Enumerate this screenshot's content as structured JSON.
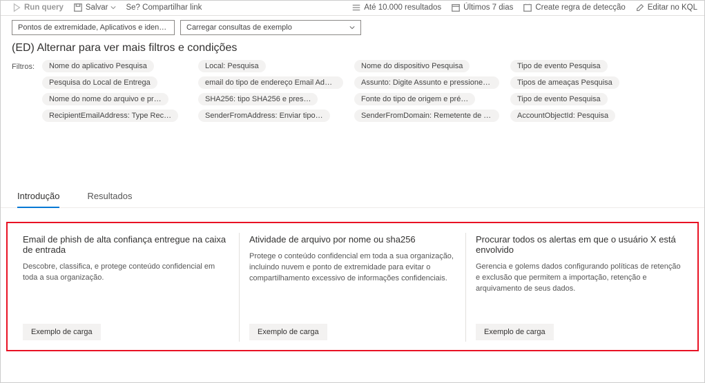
{
  "toolbar": {
    "run": "Run query",
    "save": "Salvar",
    "share": "Se? Compartilhar link",
    "results_limit": "Até 10.000 resultados",
    "time_range": "Últimos 7 dias",
    "create_rule": "Create regra de detecção",
    "edit_kql": "Editar no KQL"
  },
  "scope_box": "Pontos de extremidade, Aplicativos e identidades - Atividade\".",
  "sample_box": "Carregar consultas de exemplo",
  "heading": "(ED) Alternar para ver mais filtros e condições",
  "filters_label": "Filtros:",
  "filters": [
    "Nome do aplicativo Pesquisa",
    "Local: Pesquisa",
    "Nome do dispositivo Pesquisa",
    "Tipo de evento Pesquisa",
    "Pesquisa do Local de Entrega",
    "email do tipo de endereço Email Addres…",
    "Assunto: Digite Assunto e pressione …",
    "Tipos de ameaças Pesquisa",
    "Nome do nome do arquivo e pr…",
    "SHA256: tipo SHA256 e pres…",
    "Fonte do tipo de origem e pré…",
    "Tipo de evento Pesquisa",
    "RecipientEmailAddress: Type Rec…",
    "SenderFromAddress: Enviar tipo…",
    "SenderFromDomain: Remetente de Tipo",
    "AccountObjectId: Pesquisa"
  ],
  "tabs": {
    "intro": "Introdução",
    "results": "Resultados"
  },
  "cards": [
    {
      "title": "Email de phish de alta confiança entregue na caixa de entrada",
      "desc": "Descobre, classifica, e protege conteúdo confidencial em toda a sua organização.",
      "btn": "Exemplo de carga"
    },
    {
      "title": "Atividade de arquivo por nome ou sha256",
      "desc": "Protege o conteúdo confidencial em toda a sua organização, incluindo nuvem e ponto de extremidade para evitar o compartilhamento excessivo de informações confidenciais.",
      "btn": "Exemplo de carga"
    },
    {
      "title": "Procurar todos os alertas em que o usuário X está envolvido",
      "desc": "Gerencia e golems dados configurando políticas de retenção e exclusão que permitem a importação, retenção e arquivamento de seus dados.",
      "btn": "Exemplo de carga"
    }
  ]
}
